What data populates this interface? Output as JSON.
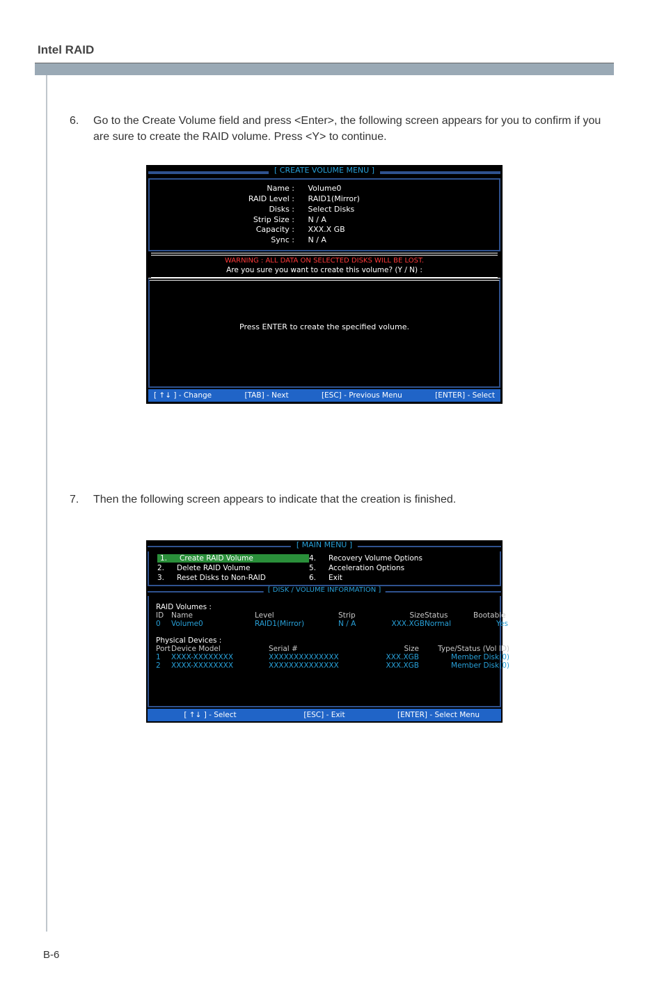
{
  "header": {
    "title": "Intel RAID"
  },
  "step6": {
    "num": "6.",
    "text": "Go to the Create Volume field and press <Enter>, the following screen appears for you to confirm if you are sure to create the RAID volume. Press <Y> to continue."
  },
  "panel1": {
    "title": "[  CREATE VOLUME MENU  ]",
    "labels": {
      "name": "Name :",
      "raid": "RAID Level :",
      "disks": "Disks :",
      "strip": "Strip Size :",
      "capacity": "Capacity :",
      "sync": "Sync :"
    },
    "values": {
      "name": "Volume0",
      "raid": "RAID1(Mirror)",
      "disks": "Select Disks",
      "strip": "N / A",
      "capacity": "XXX.X  GB",
      "sync": "N / A"
    },
    "warning": "WARNING :  ALL DATA ON SELECTED DISKS WILL BE LOST.",
    "confirm": "Are  you  sure  you  want  to  create  this  volume?  (Y / N)  :",
    "enter_msg": "Press  ENTER  to  create  the  specified  volume.",
    "footer": {
      "change": "[ ↑↓ ] - Change",
      "tab": "[TAB] - Next",
      "esc": "[ESC] - Previous Menu",
      "enter": "[ENTER] - Select"
    }
  },
  "step7": {
    "num": "7.",
    "text": "Then the following screen appears to indicate that the creation is finished."
  },
  "panel2": {
    "title": "[   MAIN  MENU   ]",
    "menu": {
      "n1": "1.",
      "t1": "Create  RAID  Volume",
      "n2": "2.",
      "t2": "Delete  RAID  Volume",
      "n3": "3.",
      "t3": "Reset Disks to Non-RAID",
      "n4": "4.",
      "t4": "Recovery Volume  Options",
      "n5": "5.",
      "t5": "Acceleration Options",
      "n6": "6.",
      "t6": "Exit"
    },
    "divtitle": "[   DISK / VOLUME INFORMATION   ]",
    "vol_section": "RAID  Volumes :",
    "vol_hdr": {
      "id": "ID",
      "name": "Name",
      "level": "Level",
      "strip": "Strip",
      "size": "Size",
      "status": "Status",
      "boot": "Bootable"
    },
    "vol_row": {
      "id": "0",
      "name": "Volume0",
      "level": "RAID1(Mirror)",
      "strip": "N / A",
      "size": "XXX.XGB",
      "status": "Normal",
      "boot": "Yes"
    },
    "phys_section": "Physical  Devices :",
    "phys_hdr": {
      "port": "Port",
      "model": "Device  Model",
      "serial": "Serial  #",
      "size": "Size",
      "ts": "Type/Status (Vol  ID)"
    },
    "phys_rows": [
      {
        "port": "1",
        "model": "XXXX-XXXXXXXX",
        "serial": "XXXXXXXXXXXXXX",
        "size": "XXX.XGB",
        "ts": "Member  Disk(0)"
      },
      {
        "port": "2",
        "model": "XXXX-XXXXXXXX",
        "serial": "XXXXXXXXXXXXXX",
        "size": "XXX.XGB",
        "ts": "Member  Disk(0)"
      }
    ],
    "footer": {
      "select": "[ ↑↓ ] - Select",
      "esc": "[ESC] - Exit",
      "enter": "[ENTER] - Select Menu"
    }
  },
  "page_footer": "B-6"
}
